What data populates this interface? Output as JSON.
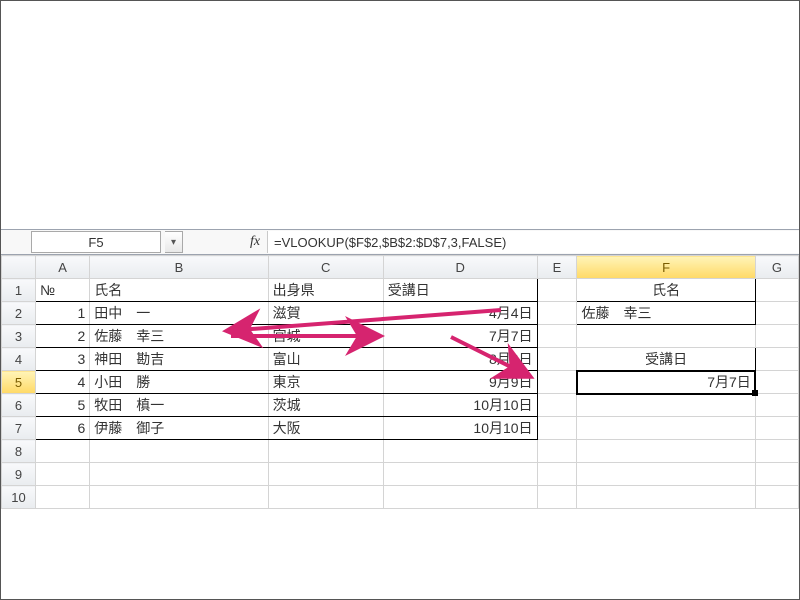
{
  "formula_bar": {
    "name_box": "F5",
    "fx_label": "fx",
    "formula": "=VLOOKUP($F$2,$B$2:$D$7,3,FALSE)"
  },
  "columns": [
    "A",
    "B",
    "C",
    "D",
    "E",
    "F",
    "G"
  ],
  "headers": {
    "no": "№",
    "name": "氏名",
    "pref": "出身県",
    "date": "受講日",
    "f_name_label": "氏名",
    "f_date_label": "受講日"
  },
  "lookup": {
    "name_value": "佐藤　幸三",
    "date_value": "7月7日"
  },
  "rows": [
    {
      "no": "1",
      "name": "田中　一",
      "pref": "滋賀",
      "date": "4月4日"
    },
    {
      "no": "2",
      "name": "佐藤　幸三",
      "pref": "宮城",
      "date": "7月7日"
    },
    {
      "no": "3",
      "name": "神田　勘吉",
      "pref": "富山",
      "date": "8月8日"
    },
    {
      "no": "4",
      "name": "小田　勝",
      "pref": "東京",
      "date": "9月9日"
    },
    {
      "no": "5",
      "name": "牧田　槙一",
      "pref": "茨城",
      "date": "10月10日"
    },
    {
      "no": "6",
      "name": "伊藤　御子",
      "pref": "大阪",
      "date": "10月10日"
    }
  ],
  "arrow_color": "#d6246f"
}
